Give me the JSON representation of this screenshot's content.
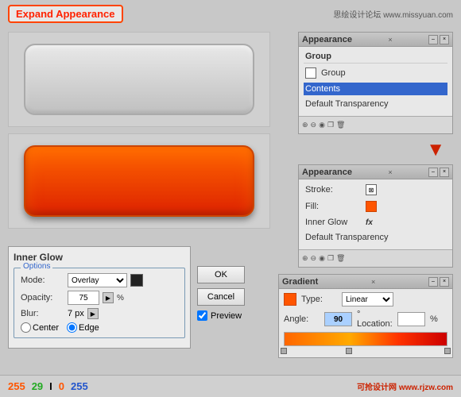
{
  "banner": {
    "title": "Expand Appearance",
    "site_info": "思绘设计论坛 www.missyuan.com"
  },
  "gray_rect": {
    "label": "gray rounded rectangle"
  },
  "orange_rect": {
    "label": "orange rounded rectangle with inner glow"
  },
  "appearance_panel_1": {
    "title": "Appearance",
    "group_label": "Group",
    "contents_label": "Contents",
    "transparency_label": "Default Transparency",
    "close_x": "×",
    "minimize": "–"
  },
  "appearance_panel_2": {
    "title": "Appearance",
    "stroke_label": "Stroke:",
    "fill_label": "Fill:",
    "inner_glow_label": "Inner Glow",
    "transparency_label": "Default Transparency",
    "fx_label": "fx"
  },
  "inner_glow": {
    "title": "Inner Glow",
    "options_title": "Options",
    "mode_label": "Mode:",
    "mode_value": "Overlay",
    "opacity_label": "Opacity:",
    "opacity_value": "75",
    "opacity_unit": "%",
    "blur_label": "Blur:",
    "blur_value": "7 px",
    "center_label": "Center",
    "edge_label": "Edge",
    "ok_label": "OK",
    "cancel_label": "Cancel",
    "preview_label": "Preview"
  },
  "gradient_panel": {
    "title": "Gradient",
    "type_label": "Type:",
    "type_value": "Linear",
    "angle_label": "Angle:",
    "angle_value": "90",
    "location_label": "° Location:",
    "location_unit": "%"
  },
  "bottom_bar": {
    "num1": "255",
    "num2": "29",
    "num3": "0",
    "separator": "I",
    "num4": "255",
    "site_url": "可抢设计网 www.rjzw.com"
  }
}
